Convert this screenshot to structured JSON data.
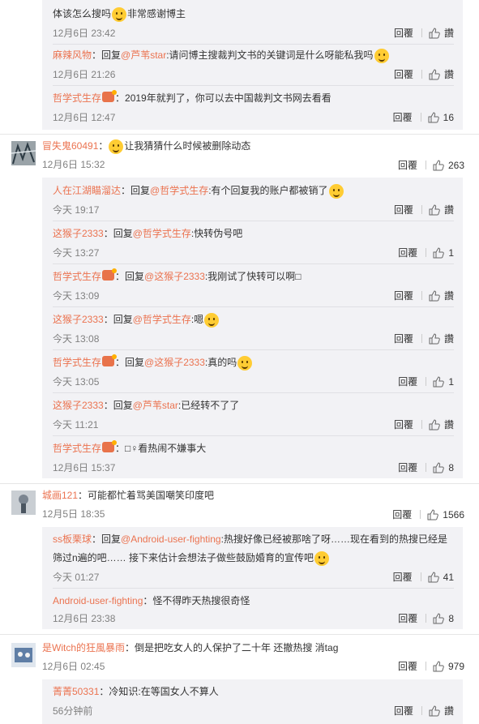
{
  "actions": {
    "reply": "回覆",
    "like": "讚"
  },
  "first_group": [
    {
      "text": "体该怎么搜吗",
      "after": "非常感谢博主",
      "meta": "12月6日 23:42",
      "like": "讚"
    },
    {
      "name": "麻辣风物",
      "pre": "：回复",
      "mention": "@芦苇star",
      "text": ":请问博主搜裁判文书的关键词是什么呀能私我吗",
      "meta": "12月6日 21:26",
      "like": "讚"
    },
    {
      "name": "哲学式生存",
      "text": "：2019年就判了，你可以去中国裁判文书网去看看",
      "meta": "12月6日 12:47",
      "like": "16"
    }
  ],
  "threads": [
    {
      "name": "冒失鬼60491",
      "text": "让我猜猜什么时候被删除动态",
      "meta": "12月6日 15:32",
      "likes": "263",
      "replies": [
        {
          "name": "人在江湖瞄溜达",
          "pre": "：回复",
          "mention": "@哲学式生存",
          "text": ":有个回复我的账户都被销了",
          "meta": "今天 19:17",
          "like": "讚"
        },
        {
          "name": "这猴子2333",
          "pre": "：回复",
          "mention": "@哲学式生存",
          "text": ":快转伪号吧",
          "meta": "今天 13:27",
          "like": "1"
        },
        {
          "name": "哲学式生存",
          "pre": "：回复",
          "mention": "@这猴子2333",
          "text": ":我刚试了快转可以啊□",
          "meta": "今天 13:09",
          "like": "讚"
        },
        {
          "name": "这猴子2333",
          "pre": "：回复",
          "mention": "@哲学式生存",
          "text": ":嗯",
          "meta": "今天 13:08",
          "like": "讚"
        },
        {
          "name": "哲学式生存",
          "pre": "：回复",
          "mention": "@这猴子2333",
          "text": ":真的吗",
          "meta": "今天 13:05",
          "like": "1"
        },
        {
          "name": "这猴子2333",
          "pre": "：回复",
          "mention": "@芦苇star",
          "text": ":已经转不了了",
          "meta": "今天 11:21",
          "like": "讚"
        },
        {
          "name": "哲学式生存",
          "pre": "",
          "mention": "",
          "text": "：□♀看热闹不嫌事大",
          "meta": "12月6日 15:37",
          "like": "8"
        }
      ]
    },
    {
      "name": "城画121",
      "text": "：可能都忙着骂美国嘲笑印度吧",
      "meta": "12月5日 18:35",
      "likes": "1566",
      "replies": [
        {
          "name": "ss板栗球",
          "pre": "：回复",
          "mention": "@Android-user-fighting",
          "text": ":热搜好像已经被那啥了呀……现在看到的热搜已经是筛过n遍的吧…… 接下来估计会想法子做些鼓励婚育的宣传吧",
          "meta": "今天 01:27",
          "like": "41"
        },
        {
          "name": "Android-user-fighting",
          "pre": "",
          "mention": "",
          "text": "：怪不得昨天热搜很奇怪",
          "meta": "12月6日 23:38",
          "like": "8"
        }
      ]
    },
    {
      "name": "是Witch的狂風暴雨",
      "text": "：倒是把吃女人的人保护了二十年 还撤热搜 消tag",
      "meta": "12月6日 02:45",
      "likes": "979",
      "replies": [
        {
          "name": "菁菁50331",
          "pre": "",
          "mention": "",
          "text": "：冷知识:在等国女人不算人",
          "meta": "56分钟前",
          "like": "讚"
        }
      ]
    }
  ]
}
